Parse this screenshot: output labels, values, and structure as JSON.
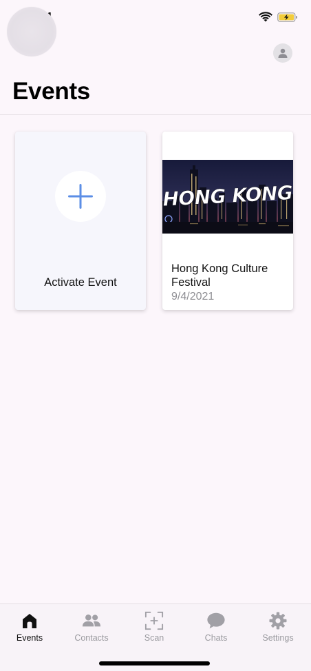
{
  "status_bar": {
    "time": "17:41"
  },
  "header": {
    "title": "Events"
  },
  "cards": {
    "activate": {
      "label": "Activate Event"
    },
    "event": {
      "image_text": "HONG KONG",
      "name": "Hong Kong Culture Festival",
      "date": "9/4/2021"
    }
  },
  "tabs": [
    {
      "label": "Events",
      "icon": "home-icon",
      "active": true
    },
    {
      "label": "Contacts",
      "icon": "contacts-icon",
      "active": false
    },
    {
      "label": "Scan",
      "icon": "scan-icon",
      "active": false
    },
    {
      "label": "Chats",
      "icon": "chat-icon",
      "active": false
    },
    {
      "label": "Settings",
      "icon": "gear-icon",
      "active": false
    }
  ],
  "colors": {
    "accent": "#5b8ee6",
    "background": "#fcf6fb",
    "inactive": "#9a9a9f",
    "active": "#111111",
    "battery": "#f2cc3a"
  }
}
